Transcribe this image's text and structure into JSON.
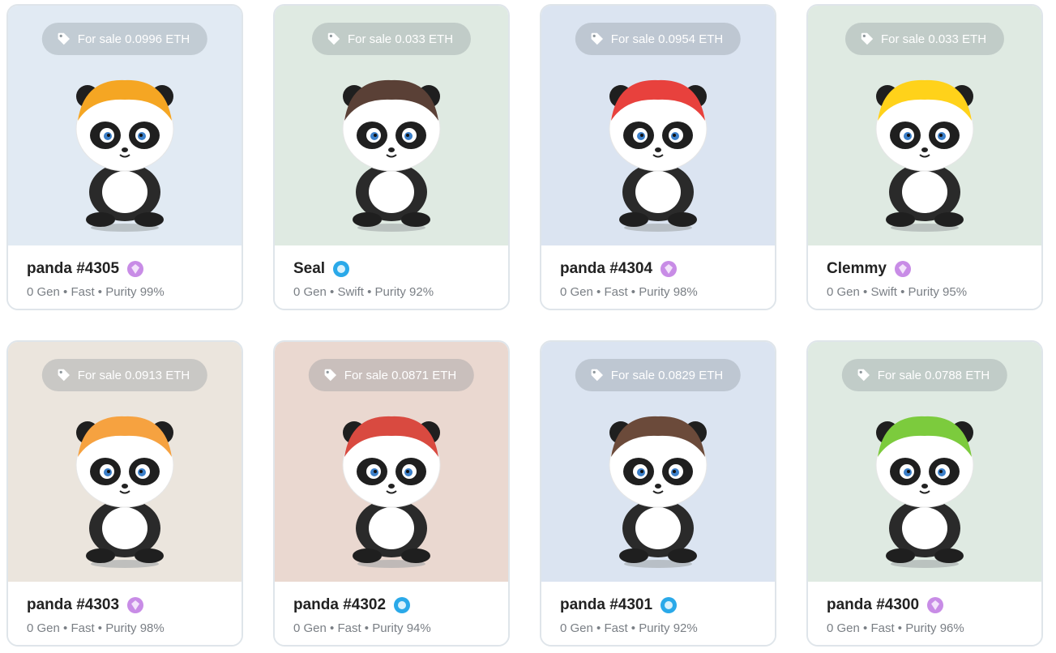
{
  "cards": [
    {
      "sale": "For sale 0.0996 ETH",
      "name": "panda #4305",
      "meta": "0 Gen • Fast • Purity 99%",
      "badge": "purple",
      "bg": "#e1eaf3",
      "hair": "#f5a623"
    },
    {
      "sale": "For sale 0.033 ETH",
      "name": "Seal",
      "meta": "0 Gen • Swift • Purity 92%",
      "badge": "blue",
      "bg": "#dfeae2",
      "hair": "#5a4036"
    },
    {
      "sale": "For sale 0.0954 ETH",
      "name": "panda #4304",
      "meta": "0 Gen • Fast • Purity 98%",
      "badge": "purple",
      "bg": "#dbe4f1",
      "hair": "#e8413d"
    },
    {
      "sale": "For sale 0.033 ETH",
      "name": "Clemmy",
      "meta": "0 Gen • Swift • Purity 95%",
      "badge": "purple",
      "bg": "#dfeae2",
      "hair": "#ffd21a"
    },
    {
      "sale": "For sale 0.0913 ETH",
      "name": "panda #4303",
      "meta": "0 Gen • Fast • Purity 98%",
      "badge": "purple",
      "bg": "#ebe5dd",
      "hair": "#f6a240"
    },
    {
      "sale": "For sale 0.0871 ETH",
      "name": "panda #4302",
      "meta": "0 Gen • Fast • Purity 94%",
      "badge": "blue",
      "bg": "#ead8d0",
      "hair": "#d94a40"
    },
    {
      "sale": "For sale 0.0829 ETH",
      "name": "panda #4301",
      "meta": "0 Gen • Fast • Purity 92%",
      "badge": "blue",
      "bg": "#dbe4f1",
      "hair": "#6b4a3a"
    },
    {
      "sale": "For sale 0.0788 ETH",
      "name": "panda #4300",
      "meta": "0 Gen • Fast • Purity 96%",
      "badge": "purple",
      "bg": "#dfeae2",
      "hair": "#7ccb3d"
    }
  ]
}
